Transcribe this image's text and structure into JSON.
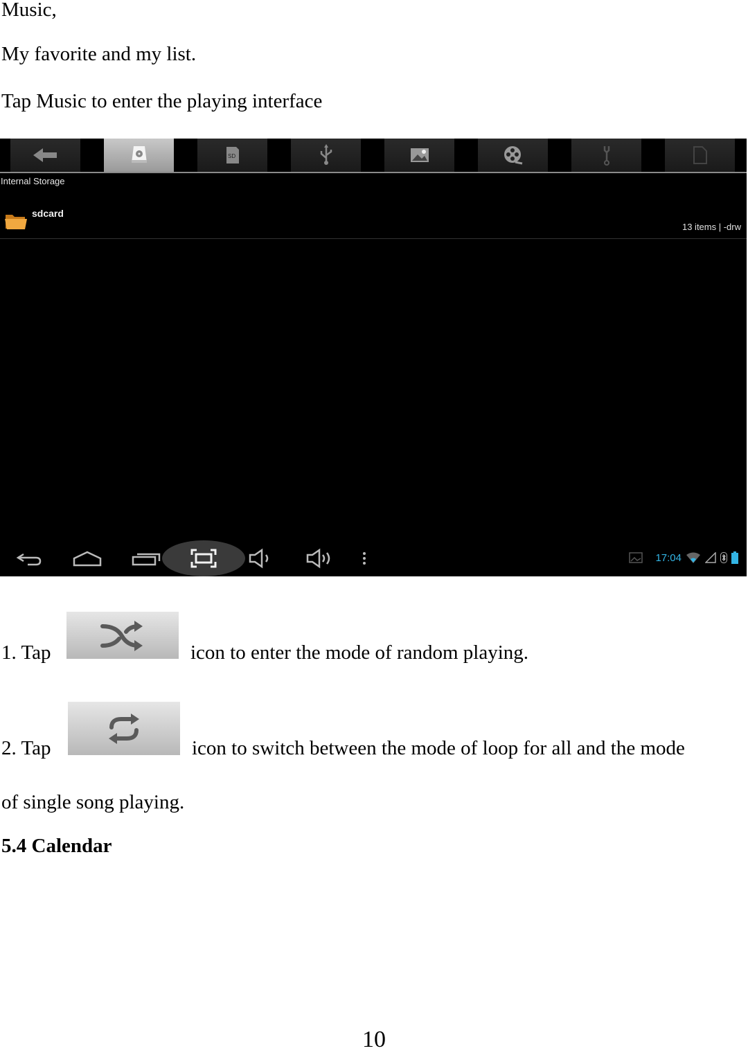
{
  "intro": {
    "line1": "Music,",
    "line2": "My favorite and my list.",
    "line3": "Tap Music to enter the playing interface"
  },
  "screenshot": {
    "tabs": [
      {
        "icon": "back-arrow-icon",
        "active": false
      },
      {
        "icon": "internal-storage-icon",
        "active": true
      },
      {
        "icon": "sd-card-icon",
        "active": false
      },
      {
        "icon": "usb-icon",
        "active": false
      },
      {
        "icon": "image-icon",
        "active": false
      },
      {
        "icon": "video-reel-icon",
        "active": false
      },
      {
        "icon": "tools-icon",
        "active": false
      },
      {
        "icon": "document-icon",
        "active": false
      }
    ],
    "location": "Internal Storage",
    "items": [
      {
        "name": "sdcard",
        "info": "13 items | -drw",
        "icon": "folder-icon"
      }
    ],
    "navbar": [
      "back-icon",
      "home-icon",
      "recent-apps-icon",
      "screenshot-icon",
      "volume-down-icon",
      "volume-up-icon",
      "menu-icon"
    ],
    "status": {
      "time": "17:04",
      "icons": [
        "gallery-notification-icon",
        "wifi-icon",
        "signal-icon",
        "bluetooth-icon",
        "battery-icon"
      ],
      "accent": "#33b5e5"
    }
  },
  "steps": [
    {
      "prefix": "1. Tap",
      "icon": "shuffle-icon",
      "text": "icon to enter the mode of random playing."
    },
    {
      "prefix": "2. Tap",
      "icon": "repeat-icon",
      "text": "icon to switch between the mode of loop for all and the mode",
      "continuation": "of single song playing."
    }
  ],
  "section_heading": "5.4 Calendar",
  "page_number": "10"
}
